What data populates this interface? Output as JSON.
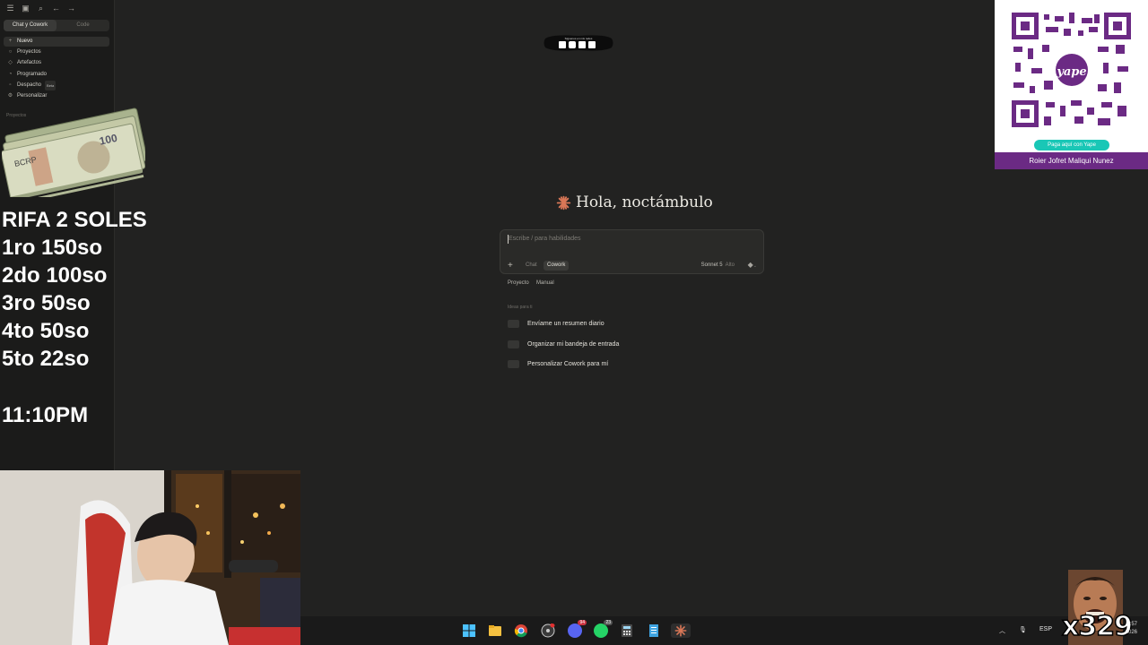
{
  "sidebar": {
    "mode_tabs": [
      "Chat y Cowork",
      "Code"
    ],
    "new_label": "Nuevo",
    "items": [
      {
        "label": "Proyectos",
        "icon": "folder-icon"
      },
      {
        "label": "Artefactos",
        "icon": "artifacts-icon"
      },
      {
        "label": "Programado",
        "icon": "clock-icon"
      },
      {
        "label": "Despacho",
        "icon": "dispatch-icon",
        "badge": "Beta"
      },
      {
        "label": "Personalizar",
        "icon": "customize-icon"
      }
    ],
    "section_label": "Proyectos"
  },
  "raffle": {
    "title": "RIFA 2 SOLES",
    "prizes": [
      "1ro 150so",
      "2do 100so",
      "3ro 50so",
      "4to 50so",
      "5to 22so"
    ],
    "time": "11:10PM"
  },
  "main": {
    "greeting": "Hola, noctámbulo",
    "composer": {
      "placeholder": "Escribe / para habilidades",
      "modes": [
        "Chat",
        "Cowork"
      ],
      "active_mode": "Cowork",
      "model": "Sonnet 5",
      "effort": "Alto"
    },
    "subtabs": [
      "Proyecto",
      "Manual"
    ],
    "ideas_label": "Ideas para ti",
    "ideas": [
      "Envíame un resumen diario",
      "Organizar mi bandeja de entrada",
      "Personalizar Cowork para mí"
    ]
  },
  "social_badge": "Síguenos en mis redes",
  "qr_panel": {
    "brand": "yape",
    "pay_button": "Paga aquí con Yape",
    "owner": "Roier Jofret Maliqui Nunez",
    "accent": "#6b2a84"
  },
  "taskbar": {
    "badges": {
      "discord": "94",
      "whatsapp": "23"
    },
    "tray_lang": "ESP",
    "clock_time": ":57",
    "clock_date": "2026"
  },
  "overlay_counter": "x329",
  "colors": {
    "claude_orange": "#d97757",
    "background": "#222221"
  }
}
